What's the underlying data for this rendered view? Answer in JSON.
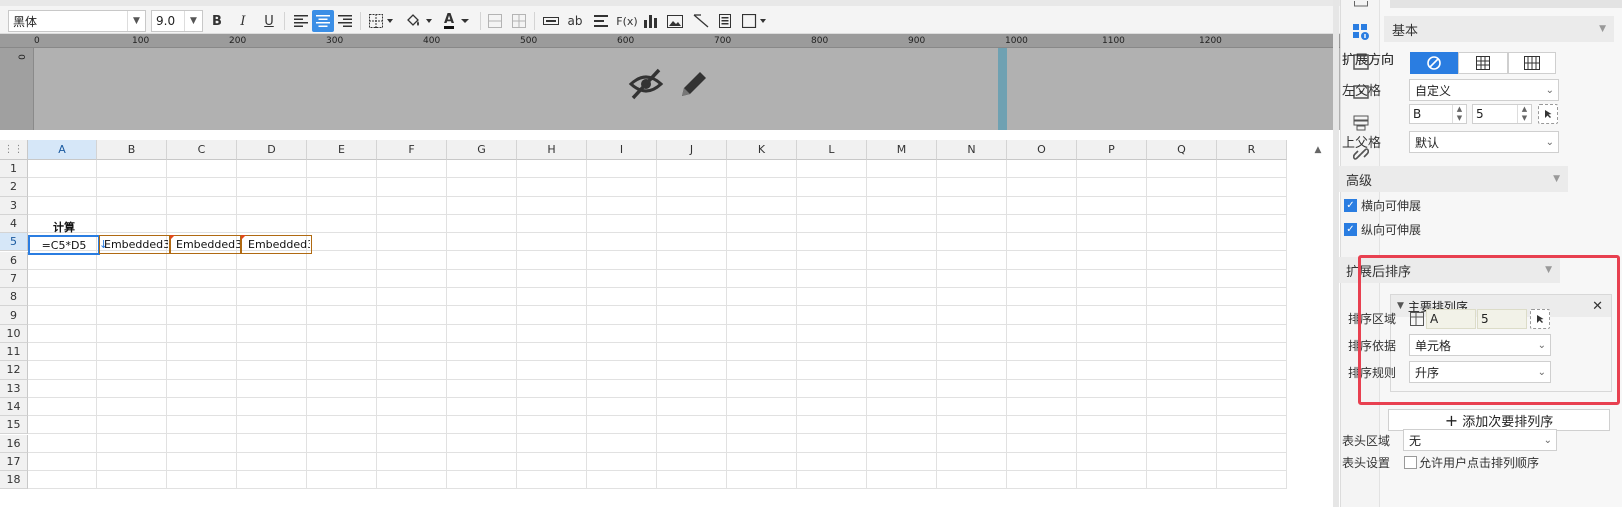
{
  "toolbar": {
    "font_name": "黑体",
    "font_size": "9.0",
    "bold_label": "B",
    "italic_label": "I",
    "underline_label": "U",
    "font_color_label": "A",
    "format_brush_label": "ab",
    "formula_label": "F(x)"
  },
  "ruler": {
    "zero_label": "0",
    "ticks": [
      "100",
      "200",
      "300",
      "400",
      "500",
      "600",
      "700",
      "800",
      "900",
      "1000",
      "1100",
      "1200"
    ]
  },
  "sheet": {
    "columns": [
      "A",
      "B",
      "C",
      "D",
      "E",
      "F",
      "G",
      "H",
      "I",
      "J",
      "K",
      "L",
      "M",
      "N",
      "O",
      "P",
      "Q",
      "R"
    ],
    "rows": [
      "1",
      "2",
      "3",
      "4",
      "5",
      "6",
      "7",
      "8",
      "9",
      "10",
      "11",
      "12",
      "13",
      "14",
      "15",
      "16",
      "17",
      "18"
    ],
    "selected_column": "A",
    "selected_row": "5",
    "cells": {
      "a4": "计算",
      "a5": "=C5*D5",
      "b5": "Embedded3.",
      "c5": "Embedded3.",
      "d5": "Embedded3."
    }
  },
  "panel": {
    "basic_title": "基本",
    "expand_direction_label": "扩展方向",
    "left_parent_label": "左父格",
    "left_parent_value": "自定义",
    "left_parent_col": "B",
    "left_parent_row": "5",
    "top_parent_label": "上父格",
    "top_parent_value": "默认",
    "advanced_title": "高级",
    "h_expandable_label": "横向可伸展",
    "v_expandable_label": "纵向可伸展",
    "sort_after_expand_title": "扩展后排序",
    "primary_sort_title": "主要排列序",
    "sort_area_label": "排序区域",
    "sort_area_col": "A",
    "sort_area_row": "5",
    "sort_by_label": "排序依据",
    "sort_by_value": "单元格",
    "sort_rule_label": "排序规则",
    "sort_rule_value": "升序",
    "add_secondary_label": "添加次要排列序",
    "header_area_label": "表头区域",
    "header_area_value": "无",
    "header_settings_label": "表头设置",
    "allow_user_sort_label": "允许用户点击排列顺序"
  },
  "colors": {
    "accent": "#2a7de1",
    "highlight_box": "#e84050"
  }
}
